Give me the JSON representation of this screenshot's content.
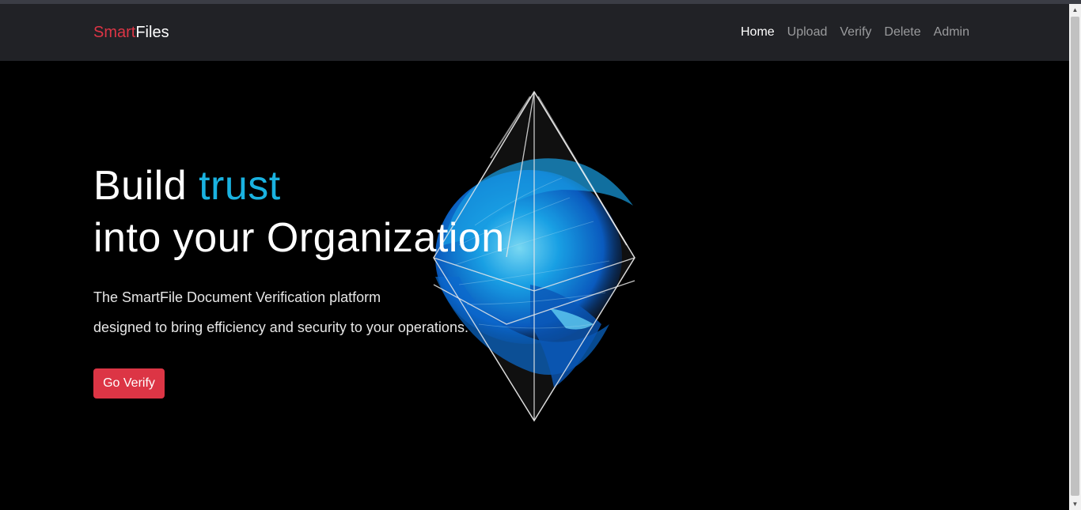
{
  "brand": {
    "part1": "Smart",
    "part2": "Files"
  },
  "nav": {
    "items": [
      "Home",
      "Upload",
      "Verify",
      "Delete",
      "Admin"
    ],
    "active": "Home"
  },
  "hero": {
    "headline_part1": "Build ",
    "headline_accent": "trust",
    "headline_line2": "into your Organization",
    "desc_line1": "The SmartFile Document Verification platform",
    "desc_line2": "designed to bring efficiency and security to your operations.",
    "cta": "Go Verify",
    "image_icon": "glass-octahedron-betta-fish"
  },
  "colors": {
    "accent_red": "#dc3545",
    "accent_blue": "#1ab2e0",
    "navbar_bg": "#212226",
    "page_bg": "#000000"
  }
}
